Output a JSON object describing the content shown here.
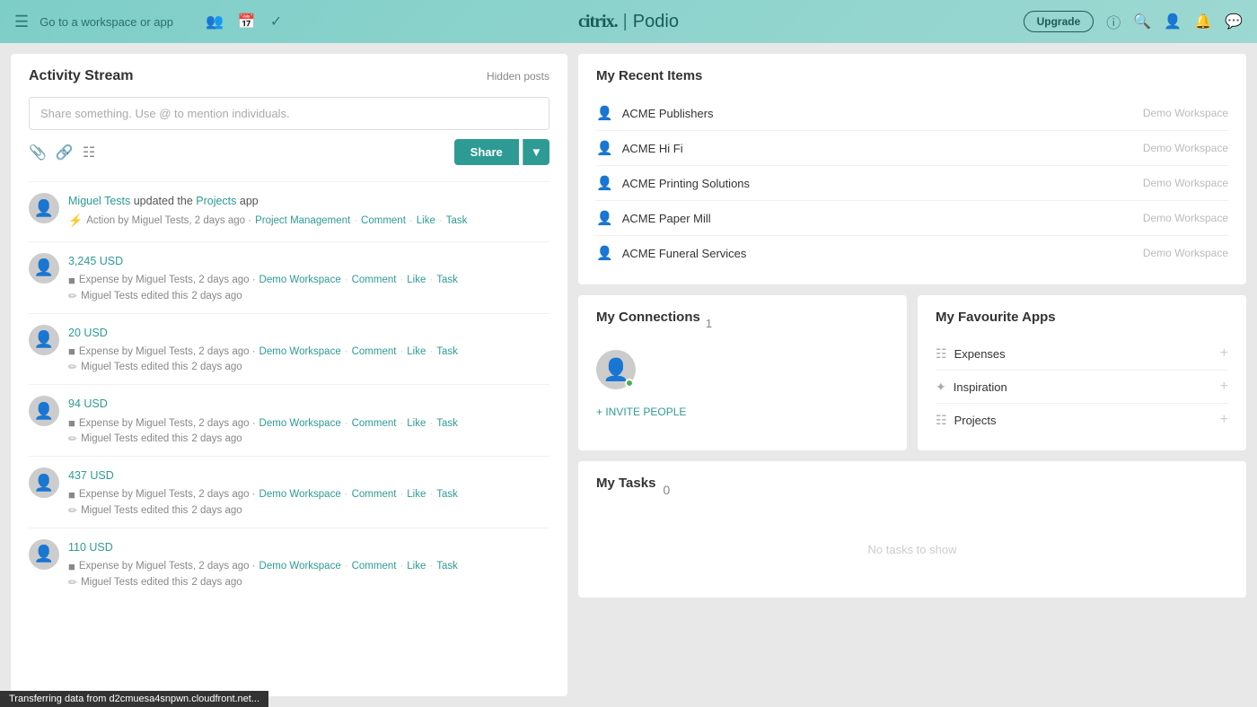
{
  "topnav": {
    "goto_label": "Go to a workspace or app",
    "logo_citrix": "citrix.",
    "logo_divider": "|",
    "logo_podio": "Podio",
    "upgrade_label": "Upgrade"
  },
  "activity_stream": {
    "title": "Activity Stream",
    "hidden_posts": "Hidden posts",
    "share_placeholder": "Share something. Use @ to mention individuals.",
    "share_button": "Share",
    "items": [
      {
        "user": "Miguel Tests",
        "action": "updated the",
        "target": "Projects",
        "suffix": "app",
        "meta_type": "Action",
        "meta_by": "Miguel Tests",
        "meta_time": "2 days ago",
        "meta_link1": "Project Management",
        "actions": [
          "Comment",
          "Like",
          "Task"
        ],
        "edit_text": null
      },
      {
        "title": "3,245 USD",
        "meta_type": "Expense",
        "meta_by": "Miguel Tests",
        "meta_time": "2 days ago",
        "meta_workspace": "Demo Workspace",
        "actions": [
          "Comment",
          "Like",
          "Task"
        ],
        "edit_user": "Miguel Tests edited this",
        "edit_time": "2 days ago"
      },
      {
        "title": "20 USD",
        "meta_type": "Expense",
        "meta_by": "Miguel Tests",
        "meta_time": "2 days ago",
        "meta_workspace": "Demo Workspace",
        "actions": [
          "Comment",
          "Like",
          "Task"
        ],
        "edit_user": "Miguel Tests edited this",
        "edit_time": "2 days ago"
      },
      {
        "title": "94 USD",
        "meta_type": "Expense",
        "meta_by": "Miguel Tests",
        "meta_time": "2 days ago",
        "meta_workspace": "Demo Workspace",
        "actions": [
          "Comment",
          "Like",
          "Task"
        ],
        "edit_user": "Miguel Tests edited this",
        "edit_time": "2 days ago"
      },
      {
        "title": "437 USD",
        "meta_type": "Expense",
        "meta_by": "Miguel Tests",
        "meta_time": "2 days ago",
        "meta_workspace": "Demo Workspace",
        "actions": [
          "Comment",
          "Like",
          "Task"
        ],
        "edit_user": "Miguel Tests edited this",
        "edit_time": "2 days ago"
      },
      {
        "title": "110 USD",
        "meta_type": "Expense",
        "meta_by": "Miguel Tests",
        "meta_time": "2 days ago",
        "meta_workspace": "Demo Workspace",
        "actions": [
          "Comment",
          "Like",
          "Task"
        ],
        "edit_user": "Miguel Tests edited this",
        "edit_time": "2 days ago"
      }
    ]
  },
  "recent_items": {
    "title": "My Recent Items",
    "items": [
      {
        "name": "ACME Publishers",
        "workspace": "Demo Workspace"
      },
      {
        "name": "ACME Hi Fi",
        "workspace": "Demo Workspace"
      },
      {
        "name": "ACME Printing Solutions",
        "workspace": "Demo Workspace"
      },
      {
        "name": "ACME Paper Mill",
        "workspace": "Demo Workspace"
      },
      {
        "name": "ACME Funeral Services",
        "workspace": "Demo Workspace"
      }
    ]
  },
  "connections": {
    "title": "My Connections",
    "count": "1",
    "invite_label": "+ INVITE PEOPLE"
  },
  "favourite_apps": {
    "title": "My Favourite Apps",
    "items": [
      {
        "name": "Expenses",
        "icon": "table"
      },
      {
        "name": "Inspiration",
        "icon": "bulb"
      },
      {
        "name": "Projects",
        "icon": "clipboard"
      }
    ]
  },
  "tasks": {
    "title": "My Tasks",
    "count": "0",
    "empty_message": "No tasks to show"
  },
  "status_bar": {
    "text": "Transferring data from d2cmuesa4snpwn.cloudfront.net..."
  }
}
